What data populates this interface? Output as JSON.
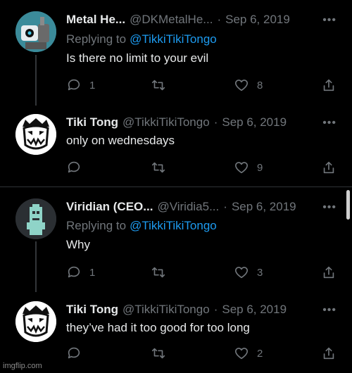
{
  "tweets": [
    {
      "name": "Metal He...",
      "handle": "@DKMetalHe...",
      "dot": "·",
      "date": "Sep 6, 2019",
      "replying_to_prefix": "Replying to",
      "replying_to_user": "@TikkiTikiTongo",
      "text": "Is there no limit to your evil",
      "replies": "1",
      "retweets": "",
      "likes": "8"
    },
    {
      "name": "Tiki Tong",
      "handle": "@TikkiTikiTongo",
      "dot": "·",
      "date": "Sep 6, 2019",
      "text": "only on wednesdays",
      "replies": "",
      "retweets": "",
      "likes": "9"
    },
    {
      "name": "Viridian (CEO...",
      "handle": "@Viridia5...",
      "dot": "·",
      "date": "Sep 6, 2019",
      "replying_to_prefix": "Replying to",
      "replying_to_user": "@TikkiTikiTongo",
      "text": "Why",
      "replies": "1",
      "retweets": "",
      "likes": "3"
    },
    {
      "name": "Tiki Tong",
      "handle": "@TikkiTikiTongo",
      "dot": "·",
      "date": "Sep 6, 2019",
      "text": "they’ve had it too good for too long",
      "replies": "",
      "retweets": "",
      "likes": "2"
    }
  ],
  "more_label": "•••",
  "watermark": "imgflip.com",
  "colors": {
    "background": "#000000",
    "text": "#e7e9ea",
    "muted": "#71767b",
    "accent": "#1d9bf0"
  }
}
